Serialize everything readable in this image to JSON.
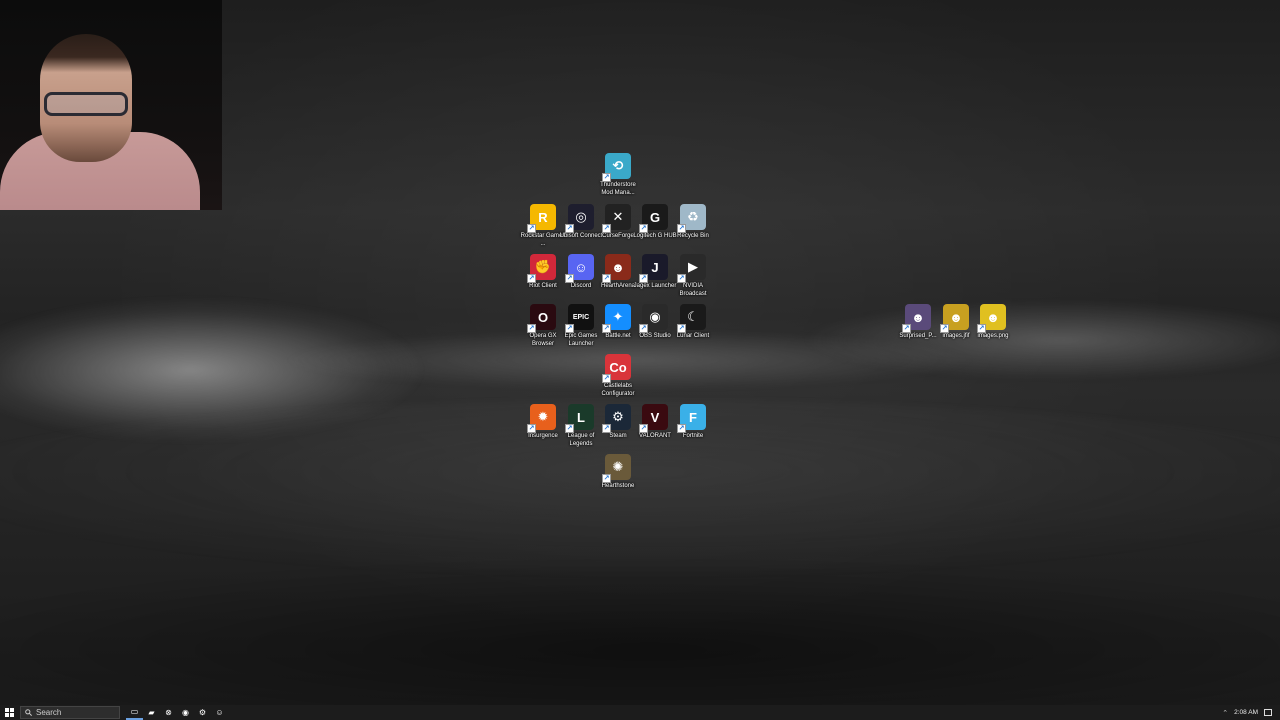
{
  "desktop": {
    "icons": [
      {
        "label": "Thunderstore Mod Mana...",
        "icon": "thunderstore-icon",
        "color": "#3aa9c9",
        "glyph": "⟲"
      },
      {
        "label": "Rockstar Games ...",
        "icon": "rockstar-icon",
        "color": "#f5b800",
        "glyph": "R"
      },
      {
        "label": "Ubisoft Connect",
        "icon": "ubisoft-icon",
        "color": "#1e1e2e",
        "glyph": "◎"
      },
      {
        "label": "CurseForge",
        "icon": "curseforge-icon",
        "color": "#222222",
        "glyph": "✕"
      },
      {
        "label": "Logitech G HUB",
        "icon": "logitech-icon",
        "color": "#1a1a1a",
        "glyph": "G"
      },
      {
        "label": "Recycle Bin",
        "icon": "recycle-bin-icon",
        "color": "#9fb8c8",
        "glyph": "♻"
      },
      {
        "label": "Riot Client",
        "icon": "riot-client-icon",
        "color": "#d1283a",
        "glyph": "✊"
      },
      {
        "label": "Discord",
        "icon": "discord-icon",
        "color": "#5865f2",
        "glyph": "☺"
      },
      {
        "label": "HearthArena",
        "icon": "heartharena-icon",
        "color": "#8a2a1a",
        "glyph": "☻"
      },
      {
        "label": "Jagex Launcher",
        "icon": "jagex-icon",
        "color": "#1a1a2a",
        "glyph": "J"
      },
      {
        "label": "NVIDIA Broadcast",
        "icon": "nvidia-icon",
        "color": "#2a2a2a",
        "glyph": "▶"
      },
      {
        "label": "Opera GX Browser",
        "icon": "opera-gx-icon",
        "color": "#2a0a10",
        "glyph": "O"
      },
      {
        "label": "Epic Games Launcher",
        "icon": "epic-games-icon",
        "color": "#111111",
        "glyph": "EPIC"
      },
      {
        "label": "Battle.net",
        "icon": "battlenet-icon",
        "color": "#148eff",
        "glyph": "✦"
      },
      {
        "label": "OBS Studio",
        "icon": "obs-icon",
        "color": "#2a2a2a",
        "glyph": "◉"
      },
      {
        "label": "Lunar Client",
        "icon": "lunar-client-icon",
        "color": "#1a1a1a",
        "glyph": "☾"
      },
      {
        "label": "Castlelabs Configurator",
        "icon": "castlelabs-icon",
        "color": "#d9343a",
        "glyph": "Co"
      },
      {
        "label": "Insurgence",
        "icon": "insurgence-icon",
        "color": "#e8601c",
        "glyph": "✹"
      },
      {
        "label": "League of Legends",
        "icon": "league-icon",
        "color": "#1a3a2a",
        "glyph": "L"
      },
      {
        "label": "Steam",
        "icon": "steam-icon",
        "color": "#1b2838",
        "glyph": "⚙"
      },
      {
        "label": "VALORANT",
        "icon": "valorant-icon",
        "color": "#3a0a10",
        "glyph": "V"
      },
      {
        "label": "Fortnite",
        "icon": "fortnite-icon",
        "color": "#3ab0e8",
        "glyph": "F"
      },
      {
        "label": "Hearthstone",
        "icon": "hearthstone-icon",
        "color": "#6a5a3a",
        "glyph": "✺"
      },
      {
        "label": "Surprised_P...",
        "icon": "image-file-icon",
        "color": "#5a4a7a",
        "glyph": "☻"
      },
      {
        "label": "images.jfif",
        "icon": "image-file-icon",
        "color": "#c8a020",
        "glyph": "☻"
      },
      {
        "label": "images.png",
        "icon": "image-file-icon",
        "color": "#e0c020",
        "glyph": "☻"
      }
    ]
  },
  "taskbar": {
    "search_placeholder": "Search",
    "apps": [
      {
        "name": "task-view",
        "glyph": "▭"
      },
      {
        "name": "file-explorer",
        "glyph": "▰"
      },
      {
        "name": "xbox",
        "glyph": "⊗"
      },
      {
        "name": "obs",
        "glyph": "◉"
      },
      {
        "name": "steam",
        "glyph": "⚙"
      },
      {
        "name": "discord",
        "glyph": "☺"
      }
    ],
    "clock": "2:08 AM"
  }
}
